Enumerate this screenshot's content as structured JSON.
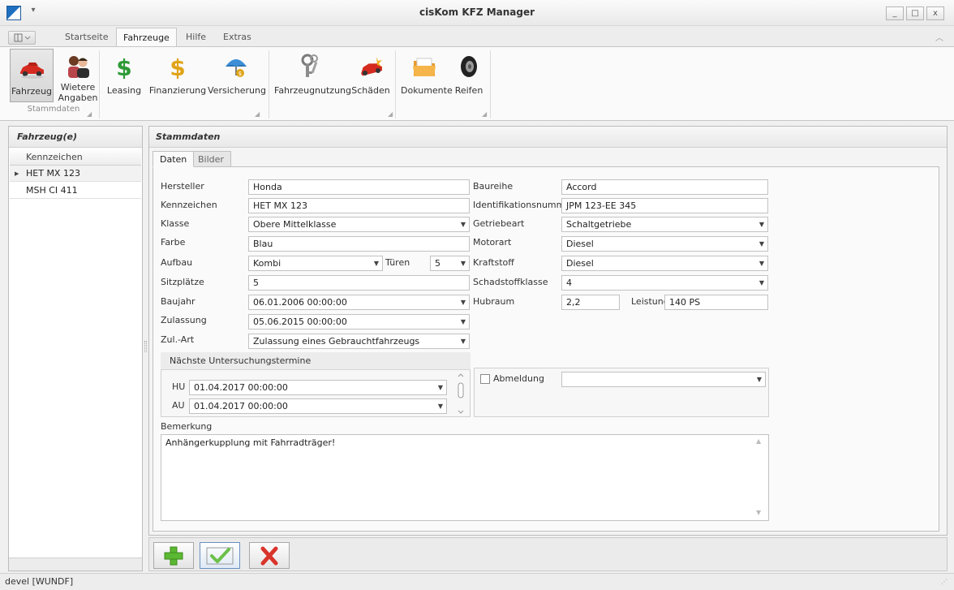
{
  "window": {
    "title": "cisKom KFZ Manager",
    "controls": [
      "_",
      "□",
      "x"
    ]
  },
  "ribbon": {
    "tabs": [
      {
        "label": "Startseite",
        "active": false
      },
      {
        "label": "Fahrzeuge",
        "active": true
      },
      {
        "label": "Hilfe",
        "active": false
      },
      {
        "label": "Extras",
        "active": false
      }
    ],
    "buttons": [
      {
        "label": "Fahrzeug",
        "icon": "car-icon",
        "selected": true
      },
      {
        "label": "Wietere",
        "label2": "Angaben",
        "icon": "people-icon"
      },
      {
        "label": "Leasing",
        "icon": "dollar-icon"
      },
      {
        "label": "Finanzierung",
        "icon": "money-bag-icon"
      },
      {
        "label": "Versicherung",
        "icon": "umbrella-icon"
      },
      {
        "label": "Fahrzeugnutzung",
        "icon": "keys-icon"
      },
      {
        "label": "Schäden",
        "icon": "crashed-car-icon"
      },
      {
        "label": "Dokumente",
        "icon": "folder-icon"
      },
      {
        "label": "Reifen",
        "icon": "tire-icon"
      }
    ],
    "group_label": "Stammdaten"
  },
  "vehicle_list": {
    "title": "Fahrzeug(e)",
    "column": "Kennzeichen",
    "rows": [
      "HET MX 123",
      "MSH CI 411"
    ],
    "selected_index": 0
  },
  "detail": {
    "title": "Stammdaten",
    "tabs": [
      {
        "label": "Daten",
        "active": true
      },
      {
        "label": "Bilder",
        "active": false
      }
    ],
    "labels": {
      "hersteller": "Hersteller",
      "kennzeichen": "Kennzeichen",
      "klasse": "Klasse",
      "farbe": "Farbe",
      "aufbau": "Aufbau",
      "tueren": "Türen",
      "sitzplaetze": "Sitzplätze",
      "baujahr": "Baujahr",
      "zulassung": "Zulassung",
      "zulart": "Zul.-Art",
      "baureihe": "Baureihe",
      "ident": "Identifikationsnummer",
      "getriebeart": "Getriebeart",
      "motorart": "Motorart",
      "kraftstoff": "Kraftstoff",
      "schadstoff": "Schadstoffklasse",
      "hubraum": "Hubraum",
      "leistung": "Leistung",
      "bemerkung": "Bemerkung"
    },
    "values": {
      "hersteller": "Honda",
      "kennzeichen": "HET MX 123",
      "klasse": "Obere Mittelklasse",
      "farbe": "Blau",
      "aufbau": "Kombi",
      "tueren": "5",
      "sitzplaetze": "5",
      "baujahr": "06.01.2006 00:00:00",
      "zulassung": "05.06.2015 00:00:00",
      "zulart": "Zulassung eines Gebrauchtfahrzeugs",
      "baureihe": "Accord",
      "ident": "JPM 123-EE 345",
      "getriebeart": "Schaltgetriebe",
      "motorart": "Diesel",
      "kraftstoff": "Diesel",
      "schadstoff": "4",
      "hubraum": "2,2",
      "leistung": "140 PS",
      "abmeldung": "",
      "bemerkung": "Anhängerkupplung mit Fahrradträger!"
    },
    "inspection": {
      "title": "Nächste Untersuchungstermine",
      "hu_label": "HU",
      "hu_value": "01.04.2017 00:00:00",
      "au_label": "AU",
      "au_value": "01.04.2017 00:00:00"
    },
    "abmeldung": {
      "label": "Abmeldung",
      "checked": false
    }
  },
  "actions": [
    {
      "name": "add-button",
      "icon": "plus-icon",
      "color": "#5bb832"
    },
    {
      "name": "confirm-button",
      "icon": "checkmark-icon",
      "color": "#6cc04a"
    },
    {
      "name": "delete-button",
      "icon": "x-icon",
      "color": "#d9342b"
    }
  ],
  "status": {
    "text": "devel  [WUNDF]"
  }
}
